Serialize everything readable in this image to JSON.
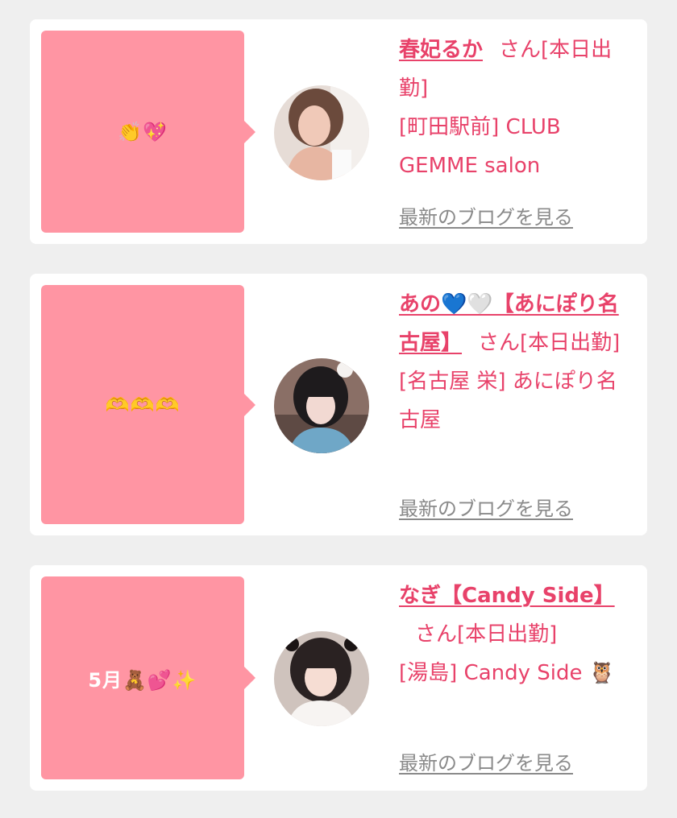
{
  "posts": [
    {
      "bubble": "👏💖",
      "name": "春妃るか",
      "suffix": "さん[本日出勤]",
      "shop": "[町田駅前] CLUB GEMME salon",
      "blog_link": "最新のブログを見る"
    },
    {
      "bubble": "🫶🫶🫶",
      "name": "あの💙🤍【あにぽり名古屋】",
      "suffix": "さん[本日出勤]",
      "shop": "[名古屋 栄] あにぽり名古屋",
      "blog_link": "最新のブログを見る"
    },
    {
      "bubble": "5月🧸💕✨",
      "name": "なぎ【Candy Side】",
      "suffix": "さん[本日出勤]",
      "shop": "[湯島] Candy Side 🦉",
      "blog_link": "最新のブログを見る"
    }
  ],
  "colors": {
    "page_background": "#efefef",
    "card_background": "#ffffff",
    "bubble_pink": "#ff95a3",
    "accent_pink": "#e8426a",
    "link_gray": "#8a8a8a"
  }
}
